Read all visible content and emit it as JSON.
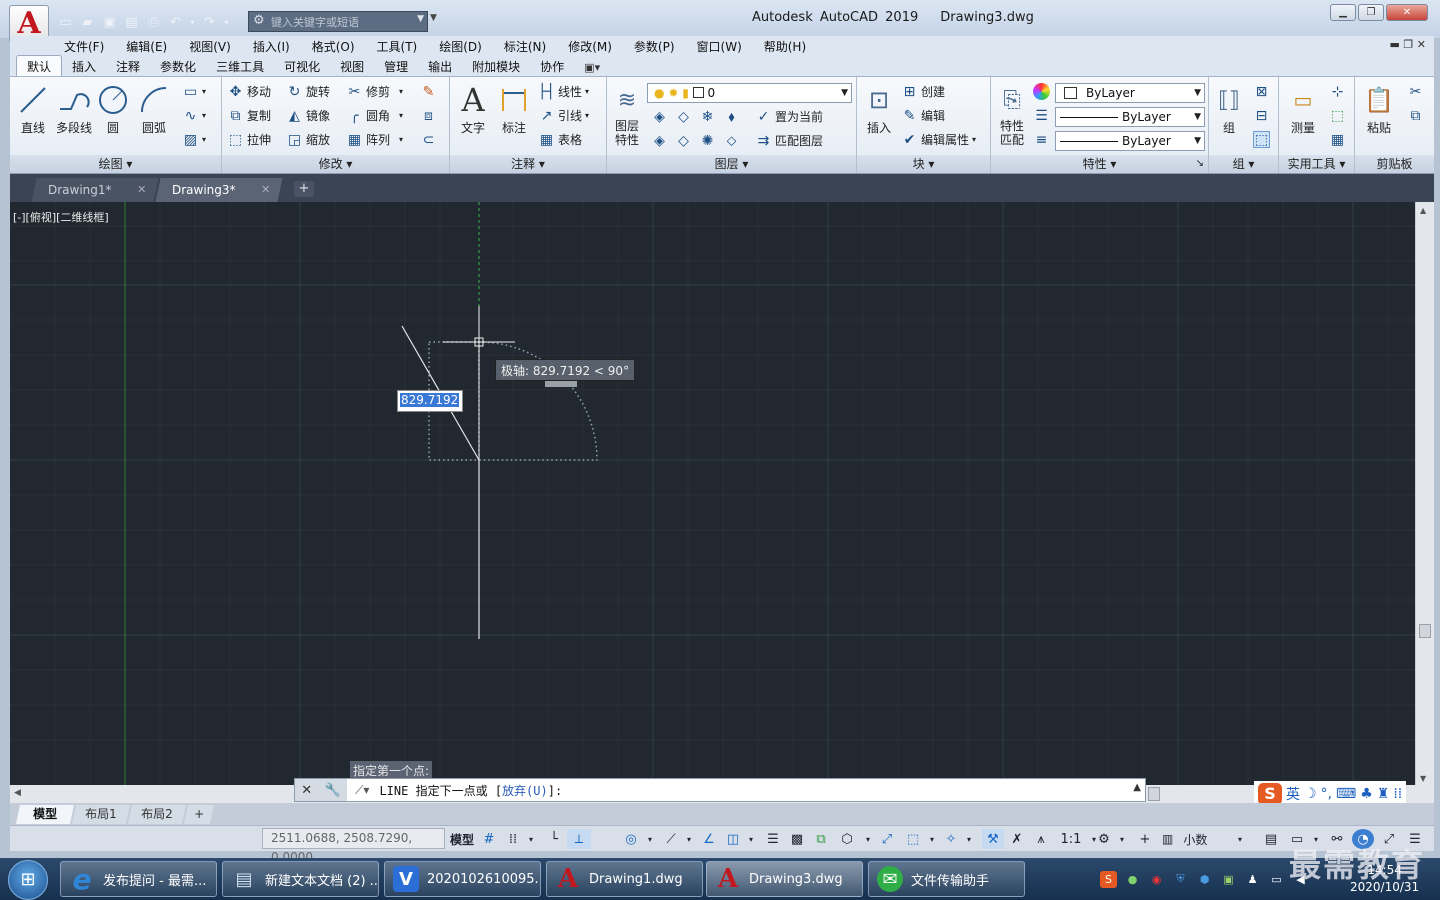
{
  "app": {
    "title": "Autodesk AutoCAD 2019",
    "document": "Drawing3.dwg",
    "logo": "A"
  },
  "search": {
    "placeholder": "键入关键字或短语"
  },
  "menu": [
    "文件(F)",
    "编辑(E)",
    "视图(V)",
    "插入(I)",
    "格式(O)",
    "工具(T)",
    "绘图(D)",
    "标注(N)",
    "修改(M)",
    "参数(P)",
    "窗口(W)",
    "帮助(H)"
  ],
  "ribbon_tabs": [
    "默认",
    "插入",
    "注释",
    "参数化",
    "三维工具",
    "可视化",
    "视图",
    "管理",
    "输出",
    "附加模块",
    "协作"
  ],
  "ribbon": {
    "draw": {
      "title": "绘图",
      "line": "直线",
      "polyline": "多段线",
      "circle": "圆",
      "arc": "圆弧"
    },
    "modify": {
      "title": "修改",
      "move": "移动",
      "rotate": "旋转",
      "trim": "修剪",
      "copy": "复制",
      "mirror": "镜像",
      "fillet": "圆角",
      "stretch": "拉伸",
      "scale": "缩放",
      "array": "阵列"
    },
    "annotation": {
      "title": "注释",
      "text": "文字",
      "dimension": "标注",
      "linear": "线性",
      "leader": "引线",
      "table": "表格"
    },
    "layers": {
      "title": "图层",
      "props_line1": "图层",
      "props_line2": "特性",
      "current_layer": "0",
      "make_current": "置为当前",
      "match_layer": "匹配图层"
    },
    "block": {
      "title": "块",
      "insert": "插入",
      "create": "创建",
      "edit": "编辑",
      "edit_attr": "编辑属性"
    },
    "properties": {
      "title": "特性",
      "match_line1": "特性",
      "match_line2": "匹配",
      "color": "ByLayer",
      "linetype": "ByLayer",
      "lineweight": "ByLayer"
    },
    "groups": {
      "title": "组",
      "group": "组"
    },
    "utilities": {
      "title": "实用工具",
      "measure": "测量"
    },
    "clipboard": {
      "title": "剪贴板",
      "paste": "粘贴"
    }
  },
  "file_tabs": [
    {
      "label": "Drawing1*"
    },
    {
      "label": "Drawing3*"
    }
  ],
  "viewport_label": "[-][俯视][二维线框]",
  "dyn_input": {
    "value": "829.7192",
    "tooltip": "极轴: 829.7192 < 90°"
  },
  "command": {
    "prompt_prev": "指定第一个点:",
    "cmd": "LINE",
    "text": "指定下一点或",
    "option": "放弃(U)"
  },
  "layout_tabs": [
    "模型",
    "布局1",
    "布局2"
  ],
  "status": {
    "coords": "2511.0688, 2508.7290, 0.0000",
    "model": "模型",
    "scale": "1:1",
    "units": "小数"
  },
  "ime": {
    "lang": "英"
  },
  "taskbar": [
    {
      "label": "发布提问 - 最需...",
      "color": "#2f86d6",
      "icon": "e"
    },
    {
      "label": "新建文本文档 (2) ...",
      "color": "#7fa9c9",
      "icon": "▤"
    },
    {
      "label": "2020102610095...",
      "color": "#2b6fd6",
      "icon": "V"
    },
    {
      "label": "Drawing1.dwg",
      "color": "#c3171f",
      "icon": "A"
    },
    {
      "label": "Drawing3.dwg",
      "color": "#c3171f",
      "icon": "A"
    },
    {
      "label": "文件传输助手",
      "color": "#2fae48",
      "icon": "✉"
    }
  ],
  "clock": {
    "time": "14:54",
    "date": "2020/10/31"
  },
  "watermark": "最需教育"
}
